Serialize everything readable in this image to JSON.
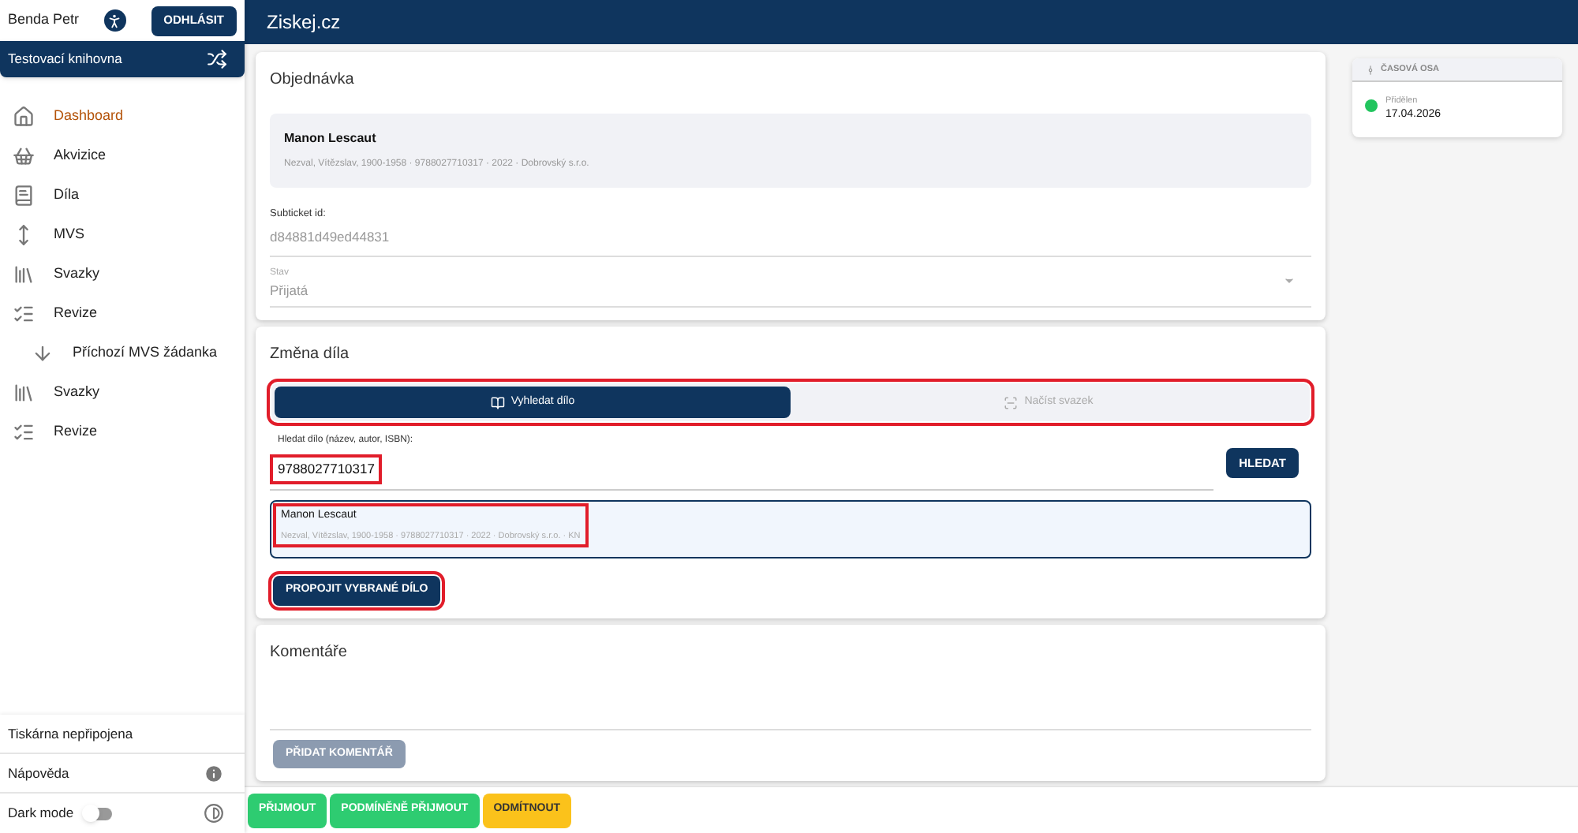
{
  "user": {
    "name": "Benda Petr",
    "logout": "ODHLÁSIT"
  },
  "library": {
    "name": "Testovací knihovna"
  },
  "nav": [
    {
      "label": "Dashboard",
      "selected": true
    },
    {
      "label": "Akvizice",
      "selected": false
    },
    {
      "label": "Díla",
      "selected": false
    },
    {
      "label": "MVS",
      "selected": false
    },
    {
      "label": "Svazky",
      "selected": false
    },
    {
      "label": "Revize",
      "selected": false,
      "children": [
        {
          "label": "Příchozí MVS žádanka",
          "selected": false
        }
      ]
    },
    {
      "label": "Svazky",
      "selected": false
    },
    {
      "label": "Revize",
      "selected": false
    }
  ],
  "sidebar_footer": {
    "printer": "Tiskárna nepřipojena",
    "help": "Nápověda",
    "dark_mode": {
      "label": "Dark mode",
      "on": false
    }
  },
  "header": {
    "title": "Ziskej.cz"
  },
  "order": {
    "title": "Objednávka",
    "book": {
      "title": "Manon Lescaut",
      "details": "Nezval, Vítězslav, 1900-1958 · 9788027710317 · 2022 · Dobrovský s.r.o."
    },
    "subticket": {
      "label": "Subticket id:",
      "value": "d84881d49ed44831"
    },
    "status": {
      "label": "Stav",
      "value": "Přijatá"
    }
  },
  "change": {
    "title": "Změna díla",
    "tabs": [
      {
        "label": "Vyhledat dílo",
        "selected": true
      },
      {
        "label": "Načíst svazek",
        "selected": false
      }
    ],
    "tabs_highlighted": true,
    "search": {
      "label": "Hledat dílo (název, autor, ISBN):",
      "value": "9788027710317",
      "highlighted": true
    },
    "search_button": "HLEDAT",
    "result": {
      "title": "Manon Lescaut",
      "details": "Nezval, Vítězslav, 1900-1958 · 9788027710317 · 2022 · Dobrovský s.r.o. · KN",
      "selected": true,
      "highlighted": true
    },
    "link_button": {
      "label": "PROPOJIT VYBRANÉ DÍLO",
      "highlighted": true
    }
  },
  "comments": {
    "title": "Komentáře",
    "add_button": {
      "label": "PŘIDAT KOMENTÁŘ",
      "disabled": true
    }
  },
  "timeline": {
    "title": "ČASOVÁ OSA",
    "events": [
      {
        "label": "Přidělen",
        "date": "17.04.2026",
        "color": "#22c55e"
      }
    ]
  },
  "actions": [
    {
      "label": "PŘIJMOUT",
      "color": "#2ecc71"
    },
    {
      "label": "PODMÍNĚNĚ PŘIJMOUT",
      "color": "#2ecc71"
    },
    {
      "label": "ODMÍTNOUT",
      "color": "#fbc21b"
    }
  ]
}
